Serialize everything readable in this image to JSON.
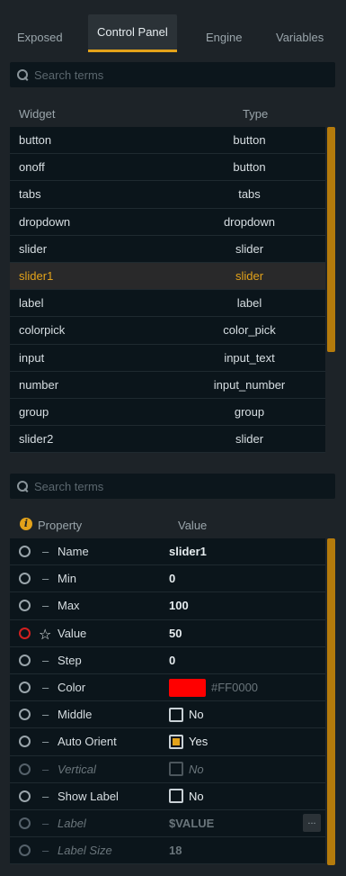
{
  "tabs": [
    "Exposed",
    "Control Panel",
    "Engine",
    "Variables"
  ],
  "widget_search": {
    "placeholder": "Search terms"
  },
  "widget_columns": {
    "widget": "Widget",
    "type": "Type"
  },
  "widgets": [
    {
      "name": "button",
      "type": "button"
    },
    {
      "name": "onoff",
      "type": "button"
    },
    {
      "name": "tabs",
      "type": "tabs"
    },
    {
      "name": "dropdown",
      "type": "dropdown"
    },
    {
      "name": "slider",
      "type": "slider"
    },
    {
      "name": "slider1",
      "type": "slider"
    },
    {
      "name": "label",
      "type": "label"
    },
    {
      "name": "colorpick",
      "type": "color_pick"
    },
    {
      "name": "input",
      "type": "input_text"
    },
    {
      "name": "number",
      "type": "input_number"
    },
    {
      "name": "group",
      "type": "group"
    },
    {
      "name": "slider2",
      "type": "slider"
    }
  ],
  "selected_widget": "slider1",
  "property_search": {
    "placeholder": "Search terms"
  },
  "property_columns": {
    "property": "Property",
    "value": "Value",
    "info_icon": "i"
  },
  "properties": {
    "name": {
      "label": "Name",
      "value": "slider1"
    },
    "min": {
      "label": "Min",
      "value": "0"
    },
    "max": {
      "label": "Max",
      "value": "100"
    },
    "value": {
      "label": "Value",
      "value": "50"
    },
    "step": {
      "label": "Step",
      "value": "0"
    },
    "color": {
      "label": "Color",
      "value": "#FF0000",
      "swatch": "#ff0000"
    },
    "middle": {
      "label": "Middle",
      "checked": false,
      "text": "No"
    },
    "auto_orient": {
      "label": "Auto Orient",
      "checked": true,
      "text": "Yes"
    },
    "vertical": {
      "label": "Vertical",
      "checked": false,
      "text": "No"
    },
    "show_label": {
      "label": "Show Label",
      "checked": false,
      "text": "No"
    },
    "label": {
      "label": "Label",
      "value": "$VALUE",
      "button": "..."
    },
    "label_size": {
      "label": "Label Size",
      "value": "18"
    }
  },
  "icons": {
    "search": "search-icon",
    "info": "info-icon",
    "radio": "radio-icon",
    "star": "star-icon"
  },
  "colors": {
    "accent": "#e3a21a",
    "background": "#1d2328",
    "row": "#0b151b",
    "radio_active": "#d32020"
  }
}
